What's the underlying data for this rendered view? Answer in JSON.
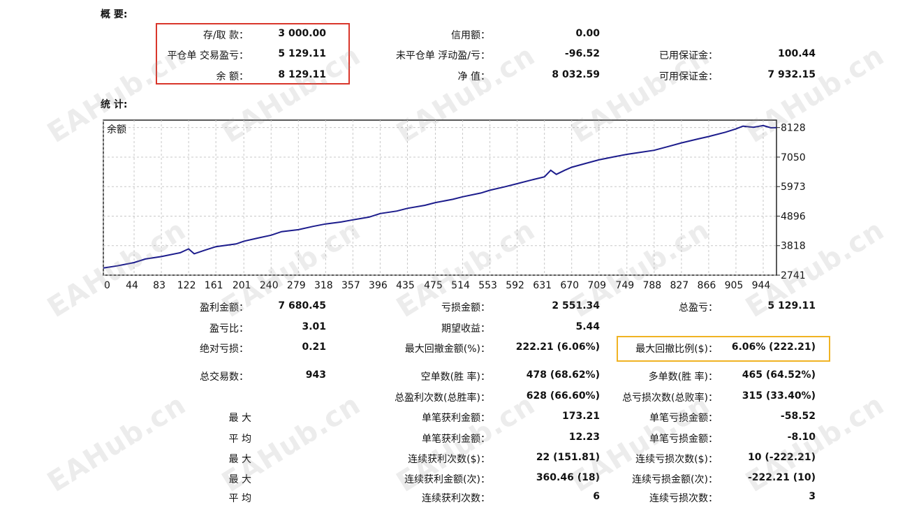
{
  "sections": {
    "summary": "概 要:",
    "stats": "统 计:"
  },
  "summary": {
    "deposit_label": "存/取 款：",
    "deposit_value": "3 000.00",
    "closed_pl_label": "平仓单 交易盈亏：",
    "closed_pl_value": "5 129.11",
    "balance_label": "余 额：",
    "balance_value": "8 129.11",
    "credit_label": "信用额：",
    "credit_value": "0.00",
    "floating_label": "未平仓单 浮动盈/亏：",
    "floating_value": "-96.52",
    "equity_label": "净 值：",
    "equity_value": "8 032.59",
    "margin_label": "已用保证金：",
    "margin_value": "100.44",
    "free_margin_label": "可用保证金：",
    "free_margin_value": "7 932.15"
  },
  "colors": {
    "highlight_red": "#d9362b",
    "highlight_yellow": "#f0b323",
    "line": "#1c1c8c"
  },
  "chart_data": {
    "type": "line",
    "title": "余额",
    "x_ticks": [
      0,
      44,
      83,
      122,
      161,
      201,
      240,
      279,
      318,
      357,
      396,
      435,
      475,
      514,
      553,
      592,
      631,
      670,
      709,
      749,
      788,
      827,
      866,
      905,
      944
    ],
    "y_ticks": [
      8128,
      7050,
      5973,
      4896,
      3818,
      2741
    ],
    "xlim": [
      0,
      963
    ],
    "ylim": [
      2741,
      8400
    ],
    "grid": true,
    "series": [
      {
        "x": [
          0,
          20,
          44,
          60,
          83,
          110,
          122,
          130,
          145,
          161,
          190,
          201,
          220,
          240,
          255,
          279,
          300,
          318,
          340,
          357,
          380,
          396,
          420,
          435,
          460,
          475,
          500,
          514,
          540,
          553,
          575,
          592,
          615,
          631,
          640,
          648,
          660,
          670,
          690,
          709,
          730,
          749,
          770,
          788,
          810,
          827,
          850,
          866,
          890,
          905,
          915,
          930,
          944,
          955,
          963
        ],
        "y": [
          3000,
          3080,
          3200,
          3330,
          3420,
          3560,
          3700,
          3520,
          3650,
          3780,
          3880,
          3980,
          4090,
          4200,
          4330,
          4400,
          4520,
          4610,
          4680,
          4760,
          4860,
          4990,
          5080,
          5180,
          5290,
          5390,
          5510,
          5600,
          5740,
          5840,
          5970,
          6080,
          6230,
          6330,
          6570,
          6420,
          6570,
          6680,
          6820,
          6950,
          7060,
          7150,
          7230,
          7300,
          7450,
          7570,
          7710,
          7800,
          7960,
          8080,
          8180,
          8140,
          8200,
          8120,
          8128
        ]
      }
    ]
  },
  "stats": {
    "gross_profit_label": "盈利金额：",
    "gross_profit_value": "7 680.45",
    "gross_loss_label": "亏损金额：",
    "gross_loss_value": "2 551.34",
    "total_pl_label": "总盈亏：",
    "total_pl_value": "5 129.11",
    "profit_factor_label": "盈亏比：",
    "profit_factor_value": "3.01",
    "expected_label": "期望收益：",
    "expected_value": "5.44",
    "abs_dd_label": "绝对亏损：",
    "abs_dd_value": "0.21",
    "max_dd_label": "最大回撤金额(%)：",
    "max_dd_value": "222.21 (6.06%)",
    "max_dd_pct_label": "最大回撤比例($)：",
    "max_dd_pct_value": "6.06% (222.21)",
    "total_trades_label": "总交易数：",
    "total_trades_value": "943",
    "short_label": "空单数(胜 率)：",
    "short_value": "478 (68.62%)",
    "long_label": "多单数(胜 率)：",
    "long_value": "465 (64.52%)",
    "profit_trades_label": "总盈利次数(总胜率)：",
    "profit_trades_value": "628 (66.60%)",
    "loss_trades_label": "总亏损次数(总败率)：",
    "loss_trades_value": "315 (33.40%)",
    "max1_label": "最 大",
    "largest_profit_label": "单笔获利金额：",
    "largest_profit_value": "173.21",
    "largest_loss_label": "单笔亏损金额：",
    "largest_loss_value": "-58.52",
    "avg1_label": "平 均",
    "avg_profit_label": "单笔获利金额：",
    "avg_profit_value": "12.23",
    "avg_loss_label": "单笔亏损金额：",
    "avg_loss_value": "-8.10",
    "max2_label": "最 大",
    "max_consec_wins_label": "连续获利次数($)：",
    "max_consec_wins_value": "22 (151.81)",
    "max_consec_losses_label": "连续亏损次数($)：",
    "max_consec_losses_value": "10 (-222.21)",
    "max3_label": "最 大",
    "max_consec_profit_label": "连续获利金额(次)：",
    "max_consec_profit_value": "360.46 (18)",
    "max_consec_loss_label": "连续亏损金额(次)：",
    "max_consec_loss_value": "-222.21 (10)",
    "avg2_label": "平 均",
    "avg_consec_wins_label": "连续获利次数：",
    "avg_consec_wins_value": "6",
    "avg_consec_losses_label": "连续亏损次数：",
    "avg_consec_losses_value": "3"
  },
  "watermark": "EAHub.cn"
}
